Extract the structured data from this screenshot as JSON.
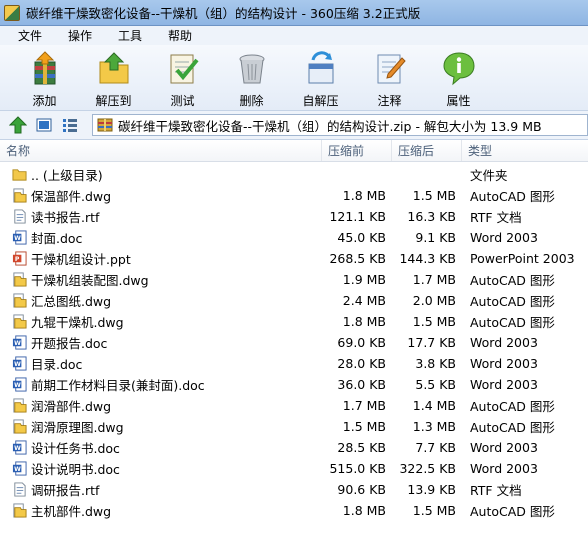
{
  "window": {
    "title": "碳纤维干燥致密化设备--干燥机（组）的结构设计 - 360压缩 3.2正式版"
  },
  "menu": [
    {
      "label": "文件"
    },
    {
      "label": "操作"
    },
    {
      "label": "工具"
    },
    {
      "label": "帮助"
    }
  ],
  "toolbar": [
    {
      "label": "添加",
      "icon": "add-archive-icon"
    },
    {
      "label": "解压到",
      "icon": "extract-to-icon"
    },
    {
      "label": "测试",
      "icon": "test-icon"
    },
    {
      "label": "删除",
      "icon": "delete-icon"
    },
    {
      "label": "自解压",
      "icon": "self-extract-icon"
    },
    {
      "label": "注释",
      "icon": "comment-icon"
    },
    {
      "label": "属性",
      "icon": "properties-icon"
    }
  ],
  "address": {
    "path": "碳纤维干燥致密化设备--干燥机（组）的结构设计.zip - 解包大小为 13.9 MB"
  },
  "columns": {
    "name": "名称",
    "compressed": "压缩前",
    "original": "压缩后",
    "type": "类型"
  },
  "files": [
    {
      "name": ".. (上级目录)",
      "compressed": "",
      "original": "",
      "type": "文件夹",
      "icon": "folder"
    },
    {
      "name": "保温部件.dwg",
      "compressed": "1.8 MB",
      "original": "1.5 MB",
      "type": "AutoCAD 图形",
      "icon": "dwg"
    },
    {
      "name": "读书报告.rtf",
      "compressed": "121.1 KB",
      "original": "16.3 KB",
      "type": "RTF 文档",
      "icon": "rtf"
    },
    {
      "name": "封面.doc",
      "compressed": "45.0 KB",
      "original": "9.1 KB",
      "type": "Word 2003",
      "icon": "doc"
    },
    {
      "name": "干燥机组设计.ppt",
      "compressed": "268.5 KB",
      "original": "144.3 KB",
      "type": "PowerPoint 2003",
      "icon": "ppt"
    },
    {
      "name": "干燥机组装配图.dwg",
      "compressed": "1.9 MB",
      "original": "1.7 MB",
      "type": "AutoCAD 图形",
      "icon": "dwg"
    },
    {
      "name": "汇总图纸.dwg",
      "compressed": "2.4 MB",
      "original": "2.0 MB",
      "type": "AutoCAD 图形",
      "icon": "dwg"
    },
    {
      "name": "九辊干燥机.dwg",
      "compressed": "1.8 MB",
      "original": "1.5 MB",
      "type": "AutoCAD 图形",
      "icon": "dwg"
    },
    {
      "name": "开题报告.doc",
      "compressed": "69.0 KB",
      "original": "17.7 KB",
      "type": "Word 2003",
      "icon": "doc"
    },
    {
      "name": "目录.doc",
      "compressed": "28.0 KB",
      "original": "3.8 KB",
      "type": "Word 2003",
      "icon": "doc"
    },
    {
      "name": "前期工作材料目录(兼封面).doc",
      "compressed": "36.0 KB",
      "original": "5.5 KB",
      "type": "Word 2003",
      "icon": "doc"
    },
    {
      "name": "润滑部件.dwg",
      "compressed": "1.7 MB",
      "original": "1.4 MB",
      "type": "AutoCAD 图形",
      "icon": "dwg"
    },
    {
      "name": "润滑原理图.dwg",
      "compressed": "1.5 MB",
      "original": "1.3 MB",
      "type": "AutoCAD 图形",
      "icon": "dwg"
    },
    {
      "name": "设计任务书.doc",
      "compressed": "28.5 KB",
      "original": "7.7 KB",
      "type": "Word 2003",
      "icon": "doc"
    },
    {
      "name": "设计说明书.doc",
      "compressed": "515.0 KB",
      "original": "322.5 KB",
      "type": "Word 2003",
      "icon": "doc"
    },
    {
      "name": "调研报告.rtf",
      "compressed": "90.6 KB",
      "original": "13.9 KB",
      "type": "RTF 文档",
      "icon": "rtf"
    },
    {
      "name": "主机部件.dwg",
      "compressed": "1.8 MB",
      "original": "1.5 MB",
      "type": "AutoCAD 图形",
      "icon": "dwg"
    }
  ]
}
